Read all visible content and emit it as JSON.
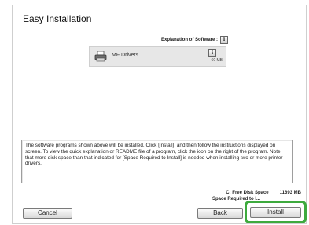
{
  "window": {
    "title": "Easy Installation"
  },
  "software": {
    "explanation_label": "Explanation of Software :",
    "info_glyph": "i",
    "items": [
      {
        "name": "MF Drivers",
        "size": "60 MB",
        "icon": "printer-icon"
      }
    ]
  },
  "description": "The software programs shown above will be installed. Click [Install], and then follow the instructions displayed on screen. To view the quick explanation or README file of a program, click the icon on the right of the program. Note that more disk space than that indicated for [Space Required to Install] is needed when installing two or more printer drivers.",
  "disk": {
    "free_label": "C: Free Disk Space",
    "free_value": "11693 MB",
    "required_label": "Space Required to I..."
  },
  "buttons": {
    "cancel": "Cancel",
    "back": "Back",
    "install": "Install"
  },
  "colors": {
    "highlight": "#3eaa3e"
  }
}
